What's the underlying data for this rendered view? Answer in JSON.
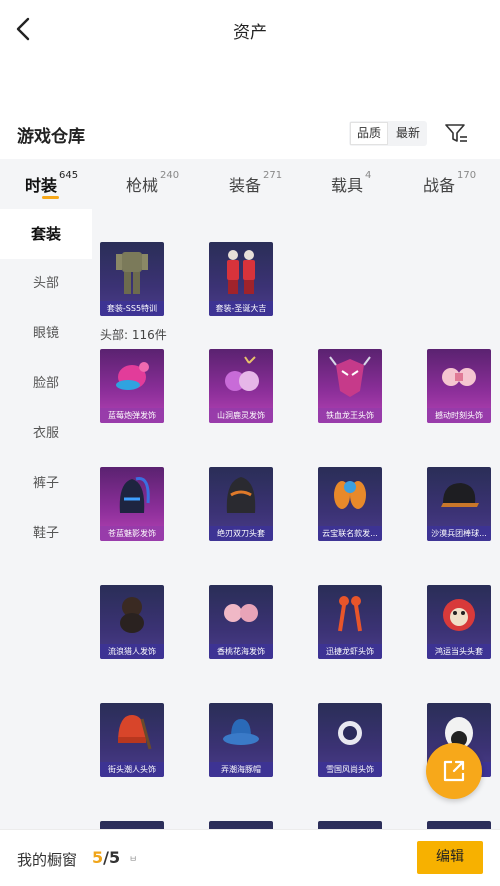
{
  "header": {
    "title": "资产"
  },
  "warehouse": {
    "title": "游戏仓库",
    "sort": [
      {
        "label": "品质"
      },
      {
        "label": "最新"
      }
    ]
  },
  "tabs": [
    {
      "label": "时装",
      "count": "645"
    },
    {
      "label": "枪械",
      "count": "240"
    },
    {
      "label": "装备",
      "count": "271"
    },
    {
      "label": "载具",
      "count": "4"
    },
    {
      "label": "战备",
      "count": "170"
    }
  ],
  "sidebar": {
    "items": [
      {
        "label": "套装"
      },
      {
        "label": "头部"
      },
      {
        "label": "眼镜"
      },
      {
        "label": "脸部"
      },
      {
        "label": "衣服"
      },
      {
        "label": "裤子"
      },
      {
        "label": "鞋子"
      }
    ]
  },
  "suits": [
    {
      "name": "套装-SS5特训"
    },
    {
      "name": "套装-圣诞大吉"
    }
  ],
  "head_section": {
    "label": "头部: 116件"
  },
  "head_items": [
    {
      "name": "蓝莓炮弹发饰"
    },
    {
      "name": "山洞鹿灵发饰"
    },
    {
      "name": "铁血龙王头饰"
    },
    {
      "name": "撼动时刻头饰"
    },
    {
      "name": "苍蓝魅影发饰"
    },
    {
      "name": "绝刃双刀头套"
    },
    {
      "name": "云宝联名款发..."
    },
    {
      "name": "沙漠兵团棒球..."
    },
    {
      "name": "流浪猎人发饰"
    },
    {
      "name": "香桃花海发饰"
    },
    {
      "name": "迅捷龙虾头饰"
    },
    {
      "name": "鸿运当头头套"
    },
    {
      "name": "街头潮人头饰"
    },
    {
      "name": "弄潮海豚帽"
    },
    {
      "name": "雪国风尚头饰"
    },
    {
      "name": ""
    }
  ],
  "bottom": {
    "label": "我的橱窗",
    "current": "5",
    "total": "/5",
    "small": "ㅂ",
    "edit": "编辑"
  }
}
